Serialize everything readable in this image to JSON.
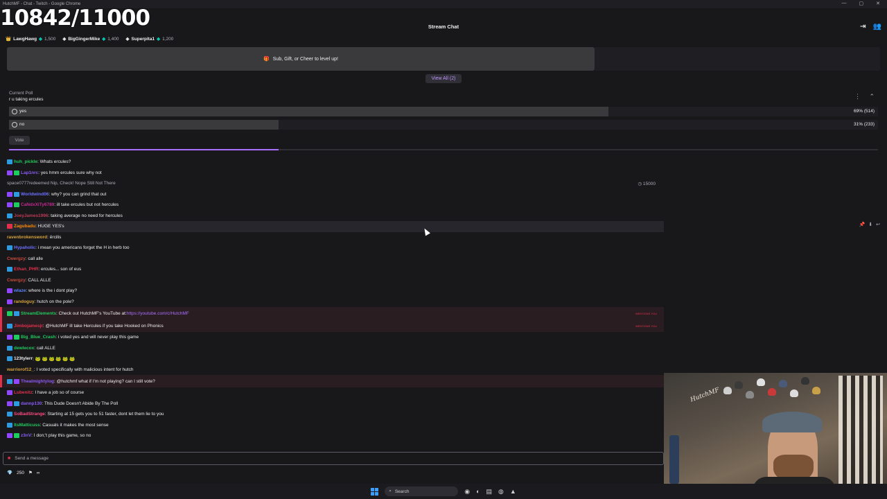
{
  "window": {
    "title": "HutchMF - Chat - Twitch - Google Chrome",
    "controls": [
      "—",
      "▢",
      "✕"
    ]
  },
  "overlay": {
    "counter": "10842/11000"
  },
  "header": {
    "title": "Stream Chat"
  },
  "leaderboard": [
    {
      "name": "LawgHawg",
      "points": "1,500",
      "icon": "crown-icon"
    },
    {
      "name": "BigGingerMike",
      "points": "1,400",
      "icon": "medal-icon"
    },
    {
      "name": "Superpita1",
      "points": "1,200",
      "icon": "medal-icon"
    }
  ],
  "banner": {
    "text": "Sub, Gift, or Cheer to level up!",
    "view_all": "View All (2)"
  },
  "poll": {
    "label": "Current Poll",
    "question": "r u taking ercules",
    "options": [
      {
        "label": "yes",
        "result": "69% (514)",
        "percent": 69
      },
      {
        "label": "no",
        "result": "31% (233)",
        "percent": 31
      }
    ],
    "vote_label": "Vote",
    "time_remaining_fraction": 0.31
  },
  "chat": [
    {
      "user": "huh_pickle",
      "text": ": Whats ercules?",
      "color": "#1ecb5f",
      "badges": [
        "#2e9ae0"
      ]
    },
    {
      "user": "Lap1nrc",
      "text": ": yes hmm ercules sure why not",
      "color": "#8a5cf5",
      "badges": [
        "#9146ff",
        "#1ecb5f"
      ]
    },
    {
      "type": "redeem",
      "user": "space0777",
      "text": " redeemed Nip, Check! Nope Still Not There",
      "points": "15000"
    },
    {
      "user": "Worldwind06",
      "text": ": why? you can grind that out",
      "color": "#6d70ff",
      "badges": [
        "#9146ff",
        "#2e9ae0"
      ]
    },
    {
      "user": "CaNdxXiTy6789",
      "text": ": ill take ercules but not hercules",
      "color": "#c02a8e",
      "badges": [
        "#9146ff",
        "#1ecb5f"
      ]
    },
    {
      "user": "JoeyJames1996",
      "text": ": taking average no need for hercules",
      "color": "#ba3a54",
      "badges": [
        "#2e9ae0"
      ]
    },
    {
      "user": "Zagubadu",
      "text": ": HUGE YES's",
      "color": "#ff8a00",
      "badges": [
        "#e0304b"
      ],
      "hover": true
    },
    {
      "user": "ravenbrokensword",
      "text": ": ërcilis",
      "color": "#d8a33a",
      "badges": []
    },
    {
      "user": "Hypaholic",
      "text": ": i mean you americans forget the H in herb too",
      "color": "#6d70ff",
      "badges": [
        "#2e9ae0"
      ]
    },
    {
      "user": "Cwergzy",
      "text": ": call alle",
      "color": "#c84a3a",
      "badges": []
    },
    {
      "user": "Ethan_PHR",
      "text": ": ercules... son of eus",
      "color": "#e0304b",
      "badges": [
        "#2e9ae0"
      ]
    },
    {
      "user": "Cwergzy",
      "text": ": CALL ALLE",
      "color": "#c84a3a",
      "badges": []
    },
    {
      "user": "wlaze",
      "text": ": where is the i dont play?",
      "color": "#5a86ff",
      "badges": [
        "#9146ff"
      ]
    },
    {
      "user": "randoguy",
      "text": ": hutch on the pole?",
      "color": "#d8a33a",
      "badges": [
        "#9146ff"
      ]
    },
    {
      "user": "StreamElements",
      "text": ": Check out HutchMF's YouTube at: ",
      "link": "https://youtube.com/c/HutchMF",
      "color": "#1ecb5f",
      "badges": [
        "#1ecb5f",
        "#2e9ae0"
      ],
      "highlight": true,
      "mention": "MENTIONS YOU"
    },
    {
      "user": "Jimbojamesjr",
      "text": ": @HutchMF ill take Hercules if you take Hooked on Phonics",
      "color": "#e0304b",
      "badges": [
        "#2e9ae0"
      ],
      "highlight": true,
      "mention": "MENTIONS YOU"
    },
    {
      "user": "Big_Blue_Crash",
      "text": ": i voted yes and will never play this game",
      "color": "#1ecb5f",
      "badges": [
        "#9146ff",
        "#1ecb5f"
      ]
    },
    {
      "user": "dewlecox",
      "text": ": call ALLE",
      "color": "#1ecb5f",
      "badges": [
        "#2e9ae0"
      ]
    },
    {
      "user": "123tylerr",
      "text": ": 🐸 🐸 🐸 🐸 🐸 🐸",
      "color": "#efeff1",
      "badges": [
        "#2e9ae0"
      ]
    },
    {
      "user": "warriorof12_",
      "text": ": I voted specifically with malicious intent for hutch",
      "color": "#d8a33a",
      "badges": []
    },
    {
      "user": "Thealmightylog",
      "text": ": @hutchmf what if I'm not playing? can I still vote?",
      "color": "#8a5cf5",
      "badges": [
        "#2e9ae0",
        "#9146ff"
      ],
      "highlight": true
    },
    {
      "user": "Lubenitz",
      "text": ": I have a job so of course",
      "color": "#e0304b",
      "badges": [
        "#9146ff"
      ]
    },
    {
      "user": "dannp130",
      "text": ": This Dude Doesn't Abide By The Poll",
      "color": "#8a5cf5",
      "badges": [
        "#9146ff",
        "#2e9ae0"
      ]
    },
    {
      "user": "SoBadStrange",
      "text": ": Starting at 15 gets you to 51 faster, dont let them lie to you",
      "color": "#ff4a80",
      "badges": [
        "#2e9ae0"
      ]
    },
    {
      "user": "ItsMatticuss",
      "text": ": Casuals it makes the most sense",
      "color": "#1ecb5f",
      "badges": [
        "#2e9ae0"
      ]
    },
    {
      "user": "z3nV",
      "text": ": I don;'t play this game, so no",
      "color": "#8a5cf5",
      "badges": [
        "#9146ff",
        "#1ecb5f"
      ]
    }
  ],
  "input": {
    "placeholder": "Send a message"
  },
  "points": {
    "value": "250",
    "infinity": "∞"
  },
  "webcam": {
    "sign_text": "HutchMF"
  },
  "taskbar": {
    "search_label": "Search"
  }
}
